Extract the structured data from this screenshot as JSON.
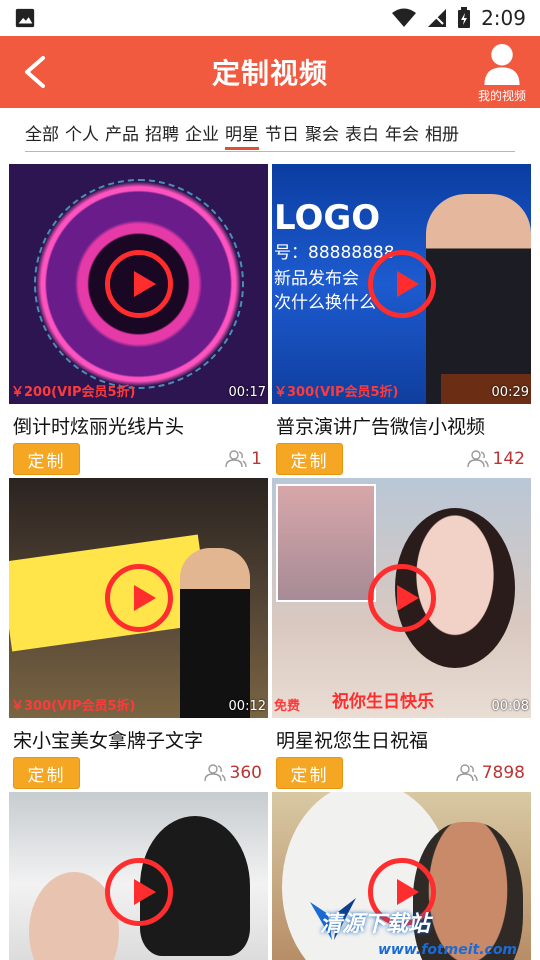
{
  "status": {
    "time": "2:09"
  },
  "header": {
    "title": "定制视频",
    "my_video_label": "我的视频"
  },
  "tabs": [
    {
      "label": "全部"
    },
    {
      "label": "个人"
    },
    {
      "label": "产品"
    },
    {
      "label": "招聘"
    },
    {
      "label": "企业"
    },
    {
      "label": "明星",
      "active": true
    },
    {
      "label": "节日"
    },
    {
      "label": "聚会"
    },
    {
      "label": "表白"
    },
    {
      "label": "年会"
    },
    {
      "label": "相册"
    }
  ],
  "cards": [
    {
      "title": "倒计时炫丽光线片头",
      "price": "￥200(VIP会员5折)",
      "duration": "00:17",
      "views": "1",
      "button": "定制"
    },
    {
      "title": "普京演讲广告微信小视频",
      "price": "￥300(VIP会员5折)",
      "duration": "00:29",
      "views": "142",
      "button": "定制",
      "thumb_text": {
        "logo": "LOGO",
        "line1": "号：88888888",
        "line2": "新品发布会",
        "line3": "次什么换什么"
      }
    },
    {
      "title": "宋小宝美女拿牌子文字",
      "price": "￥300(VIP会员5折)",
      "duration": "00:12",
      "views": "360",
      "button": "定制"
    },
    {
      "title": "明星祝您生日祝福",
      "price": "免费",
      "duration": "00:08",
      "views": "7898",
      "button": "定制",
      "caption": "祝你生日快乐"
    },
    {
      "title": "",
      "price": "",
      "duration": "",
      "views": "",
      "button": ""
    },
    {
      "title": "",
      "price": "",
      "duration": "",
      "views": "",
      "button": ""
    }
  ],
  "watermark": {
    "brand": "清源下载站",
    "url": "www.fotmeit.com"
  }
}
